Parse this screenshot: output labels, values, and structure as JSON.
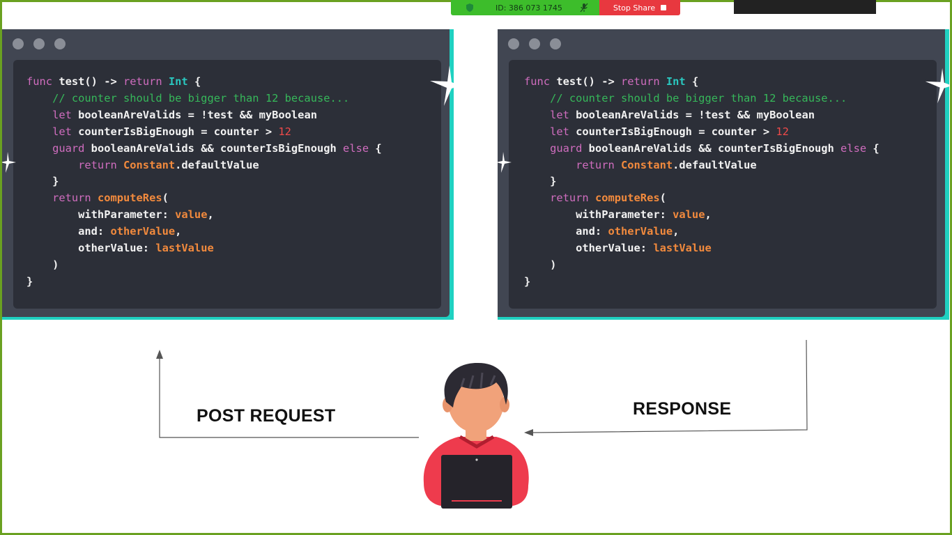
{
  "share_bar": {
    "meeting_id": "ID: 386 073 1745",
    "stop_label": "Stop Share",
    "colors": {
      "green": "#3dbd2b",
      "red": "#e8383f",
      "border": "#6aa121"
    }
  },
  "code_windows": [
    {
      "lines": [
        [
          [
            "k",
            "func "
          ],
          [
            "p",
            "test() -> "
          ],
          [
            "k",
            "return "
          ],
          [
            "t",
            "Int"
          ],
          [
            "p",
            " {"
          ]
        ],
        [
          [
            "c",
            "    // counter should be bigger than 12 because..."
          ]
        ],
        [
          [
            "k",
            "    let "
          ],
          [
            "p",
            "booleanAreValids = !test && myBoolean"
          ]
        ],
        [
          [
            "k",
            "    let "
          ],
          [
            "p",
            "counterIsBigEnough = counter > "
          ],
          [
            "n",
            "12"
          ]
        ],
        [
          [
            "k",
            "    guard "
          ],
          [
            "p",
            "booleanAreValids && counterIsBigEnough "
          ],
          [
            "k",
            "else"
          ],
          [
            "p",
            " {"
          ]
        ],
        [
          [
            "k",
            "        return "
          ],
          [
            "o",
            "Constant"
          ],
          [
            "p",
            ".defaultValue"
          ]
        ],
        [
          [
            "p",
            "    }"
          ]
        ],
        [
          [
            "k",
            "    return "
          ],
          [
            "o",
            "computeRes"
          ],
          [
            "p",
            "("
          ]
        ],
        [
          [
            "p",
            "        withParameter: "
          ],
          [
            "o",
            "value"
          ],
          [
            "p",
            ","
          ]
        ],
        [
          [
            "p",
            "        and: "
          ],
          [
            "o",
            "otherValue"
          ],
          [
            "p",
            ","
          ]
        ],
        [
          [
            "p",
            "        otherValue: "
          ],
          [
            "o",
            "lastValue"
          ]
        ],
        [
          [
            "p",
            "    )"
          ]
        ],
        [
          [
            "p",
            "}"
          ]
        ]
      ]
    },
    {
      "lines": [
        [
          [
            "k",
            "func "
          ],
          [
            "p",
            "test() -> "
          ],
          [
            "k",
            "return "
          ],
          [
            "t",
            "Int"
          ],
          [
            "p",
            " {"
          ]
        ],
        [
          [
            "c",
            "    // counter should be bigger than 12 because..."
          ]
        ],
        [
          [
            "k",
            "    let "
          ],
          [
            "p",
            "booleanAreValids = !test && myBoolean"
          ]
        ],
        [
          [
            "k",
            "    let "
          ],
          [
            "p",
            "counterIsBigEnough = counter > "
          ],
          [
            "n",
            "12"
          ]
        ],
        [
          [
            "k",
            "    guard "
          ],
          [
            "p",
            "booleanAreValids && counterIsBigEnough "
          ],
          [
            "k",
            "else"
          ],
          [
            "p",
            " {"
          ]
        ],
        [
          [
            "k",
            "        return "
          ],
          [
            "o",
            "Constant"
          ],
          [
            "p",
            ".defaultValue"
          ]
        ],
        [
          [
            "p",
            "    }"
          ]
        ],
        [
          [
            "k",
            "    return "
          ],
          [
            "o",
            "computeRes"
          ],
          [
            "p",
            "("
          ]
        ],
        [
          [
            "p",
            "        withParameter: "
          ],
          [
            "o",
            "value"
          ],
          [
            "p",
            ","
          ]
        ],
        [
          [
            "p",
            "        and: "
          ],
          [
            "o",
            "otherValue"
          ],
          [
            "p",
            ","
          ]
        ],
        [
          [
            "p",
            "        otherValue: "
          ],
          [
            "o",
            "lastValue"
          ]
        ],
        [
          [
            "p",
            "    )"
          ]
        ],
        [
          [
            "p",
            "}"
          ]
        ]
      ]
    }
  ],
  "diagram": {
    "post_label": "POST REQUEST",
    "response_label": "RESPONSE"
  }
}
